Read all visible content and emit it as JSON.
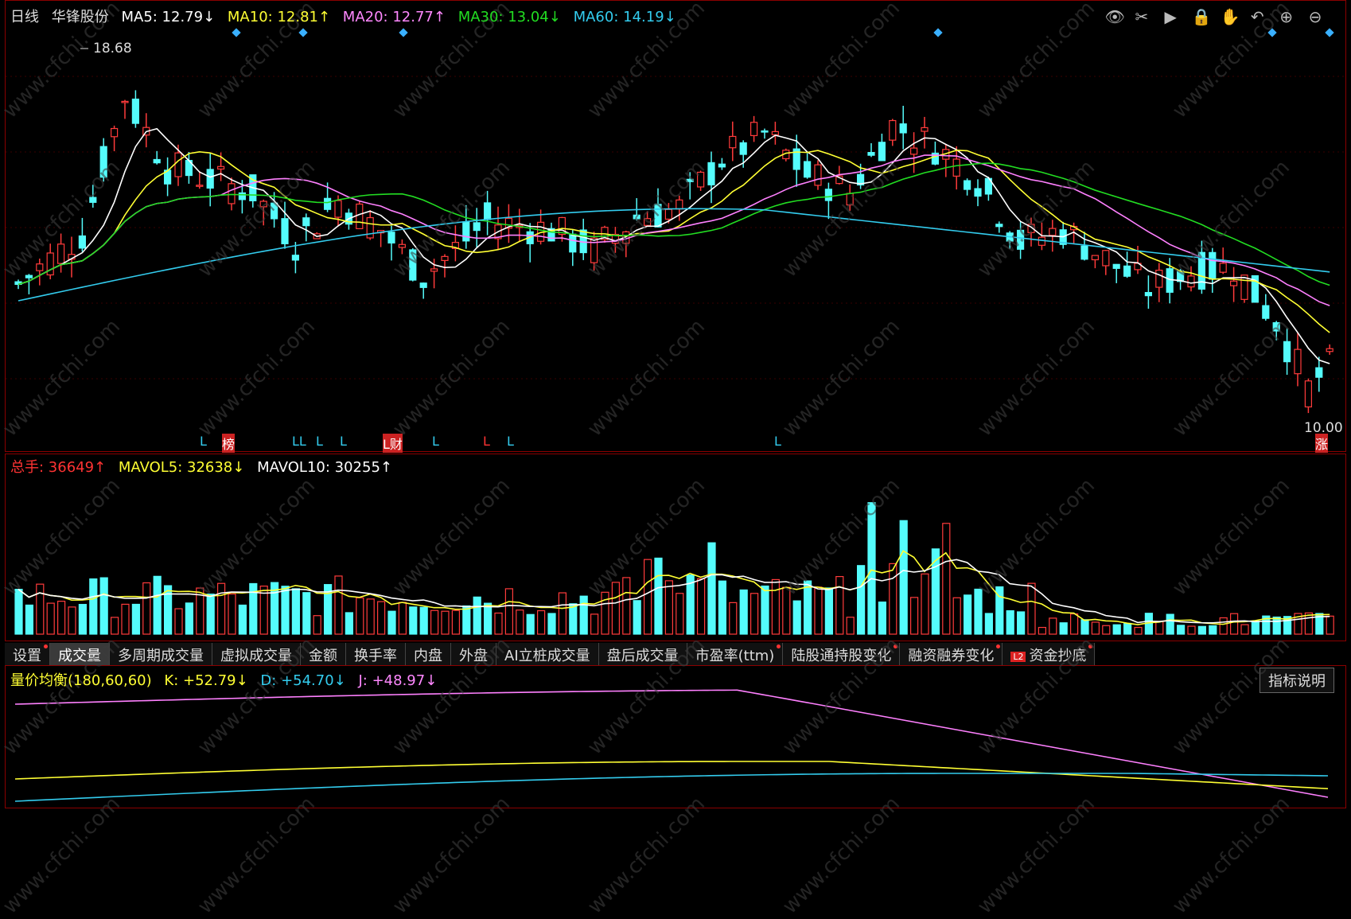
{
  "kline_header": {
    "period": "日线",
    "stock": "华锋股份",
    "ma5": "MA5: 12.79↓",
    "ma10": "MA10: 12.81↑",
    "ma20": "MA20: 12.77↑",
    "ma30": "MA30: 13.04↓",
    "ma60": "MA60: 14.19↓"
  },
  "high_label": "18.68",
  "low_label": "10.00",
  "markers": [
    "L",
    "榜",
    "LL",
    "L",
    "L",
    "L财",
    "L",
    "L",
    "L",
    "L",
    "涨"
  ],
  "vol_header": {
    "total": "总手: 36649↑",
    "mavol5": "MAVOL5: 32638↓",
    "mavol10": "MAVOL10: 30255↑"
  },
  "tabs": [
    "设置",
    "成交量",
    "多周期成交量",
    "虚拟成交量",
    "金额",
    "换手率",
    "内盘",
    "外盘",
    "AI立桩成交量",
    "盘后成交量",
    "市盈率(ttm)",
    "陆股通持股变化",
    "融资融券变化",
    "资金抄底"
  ],
  "indicator_header": {
    "name": "量价均衡(180,60,60)",
    "k": "K: +52.79↓",
    "d": "D: +54.70↓",
    "j": "J: +48.97↓"
  },
  "explain_button": "指标说明",
  "watermark": "www.cfchi.com",
  "colors": {
    "up": "#ff3b3b",
    "down": "#54fcfc",
    "ma5": "#ffffff",
    "ma10": "#ffff33",
    "ma20": "#ff80ff",
    "ma30": "#22dd22",
    "ma60": "#33ccee"
  }
}
